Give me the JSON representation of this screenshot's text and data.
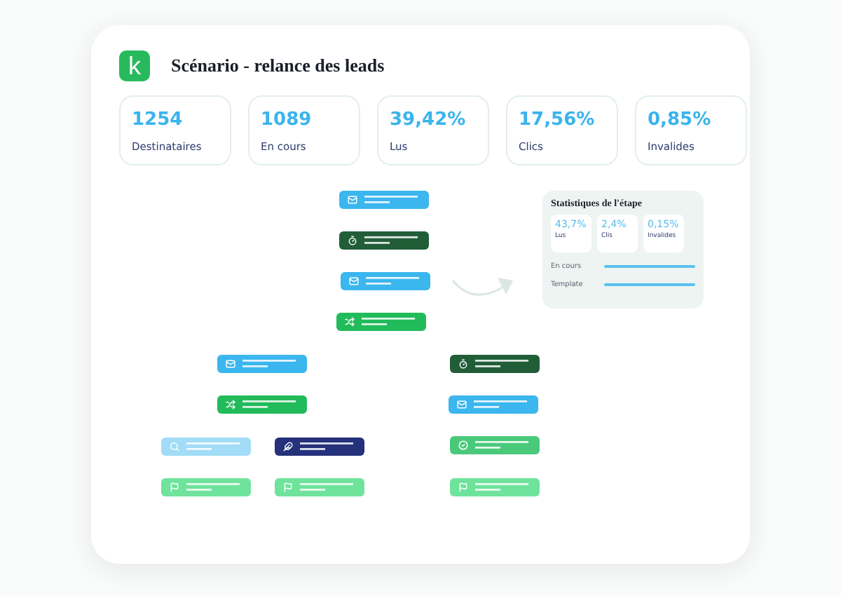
{
  "header": {
    "logo_letter": "k",
    "title": "Scénario - relance des leads"
  },
  "stats": [
    {
      "value": "1254",
      "label": "Destinataires"
    },
    {
      "value": "1089",
      "label": "En cours"
    },
    {
      "value": "39,42%",
      "label": "Lus"
    },
    {
      "value": "17,56%",
      "label": "Clics"
    },
    {
      "value": "0,85%",
      "label": "Invalides"
    }
  ],
  "flow_nodes": [
    {
      "kind": "email"
    },
    {
      "kind": "timer"
    },
    {
      "kind": "email"
    },
    {
      "kind": "split"
    },
    {
      "kind": "email"
    },
    {
      "kind": "split"
    },
    {
      "kind": "search"
    },
    {
      "kind": "edit"
    },
    {
      "kind": "flag"
    },
    {
      "kind": "flag"
    },
    {
      "kind": "timer"
    },
    {
      "kind": "email"
    },
    {
      "kind": "check"
    },
    {
      "kind": "flag"
    }
  ],
  "step_stats": {
    "title": "Statistiques de l'étape",
    "metrics": [
      {
        "value": "43,7%",
        "label": "Lus"
      },
      {
        "value": "2,4%",
        "label": "Clis"
      },
      {
        "value": "0,15%",
        "label": "Invalides"
      }
    ],
    "rows": [
      {
        "label": "En cours"
      },
      {
        "label": "Template"
      }
    ]
  }
}
